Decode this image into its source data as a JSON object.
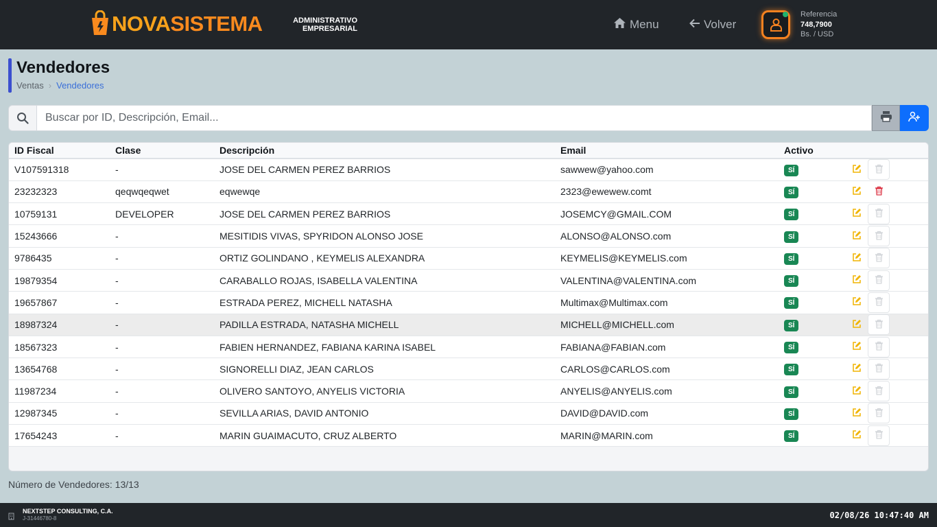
{
  "header": {
    "logo_part1": "NOVA",
    "logo_part2": "SISTEMA",
    "subtitle_line1": "ADMINISTRATIVO",
    "subtitle_line2": "EMPRESARIAL",
    "menu_label": "Menu",
    "back_label": "Volver",
    "reference_label": "Referencia",
    "reference_rate": "748,7900",
    "reference_currency": "Bs. / USD"
  },
  "page": {
    "title": "Vendedores",
    "breadcrumb": [
      "Ventas",
      "Vendedores"
    ]
  },
  "search": {
    "placeholder": "Buscar por ID, Descripción, Email..."
  },
  "table": {
    "columns": [
      "ID Fiscal",
      "Clase",
      "Descripción",
      "Email",
      "Activo"
    ],
    "rows": [
      {
        "id": "V107591318",
        "clase": "-",
        "descripcion": "JOSE DEL CARMEN PEREZ BARRIOS",
        "email": "sawwew@yahoo.com",
        "activo": "SÍ",
        "deletable": false
      },
      {
        "id": "23232323",
        "clase": "qeqwqeqwet",
        "descripcion": "eqwewqe",
        "email": "2323@ewewew.comt",
        "activo": "SÍ",
        "deletable": true
      },
      {
        "id": "10759131",
        "clase": "DEVELOPER",
        "descripcion": "JOSE DEL CARMEN PEREZ BARRIOS",
        "email": "JOSEMCY@GMAIL.COM",
        "activo": "SÍ",
        "deletable": false
      },
      {
        "id": "15243666",
        "clase": "-",
        "descripcion": "MESITIDIS VIVAS, SPYRIDON ALONSO JOSE",
        "email": "ALONSO@ALONSO.com",
        "activo": "SÍ",
        "deletable": false
      },
      {
        "id": "9786435",
        "clase": "-",
        "descripcion": "ORTIZ GOLINDANO , KEYMELIS ALEXANDRA",
        "email": "KEYMELIS@KEYMELIS.com",
        "activo": "SÍ",
        "deletable": false
      },
      {
        "id": "19879354",
        "clase": "-",
        "descripcion": "CARABALLO ROJAS, ISABELLA VALENTINA",
        "email": "VALENTINA@VALENTINA.com",
        "activo": "SÍ",
        "deletable": false
      },
      {
        "id": "19657867",
        "clase": "-",
        "descripcion": "ESTRADA PEREZ, MICHELL NATASHA",
        "email": "Multimax@Multimax.com",
        "activo": "SÍ",
        "deletable": false
      },
      {
        "id": "18987324",
        "clase": "-",
        "descripcion": "PADILLA ESTRADA, NATASHA MICHELL",
        "email": "MICHELL@MICHELL.com",
        "activo": "SÍ",
        "deletable": false,
        "highlighted": true
      },
      {
        "id": "18567323",
        "clase": "-",
        "descripcion": "FABIEN HERNANDEZ, FABIANA KARINA ISABEL",
        "email": "FABIANA@FABIAN.com",
        "activo": "SÍ",
        "deletable": false
      },
      {
        "id": "13654768",
        "clase": "-",
        "descripcion": "SIGNORELLI DIAZ, JEAN CARLOS",
        "email": "CARLOS@CARLOS.com",
        "activo": "SÍ",
        "deletable": false
      },
      {
        "id": "11987234",
        "clase": "-",
        "descripcion": "OLIVERO SANTOYO, ANYELIS VICTORIA",
        "email": "ANYELIS@ANYELIS.com",
        "activo": "SÍ",
        "deletable": false
      },
      {
        "id": "12987345",
        "clase": "-",
        "descripcion": "SEVILLA ARIAS, DAVID ANTONIO",
        "email": "DAVID@DAVID.com",
        "activo": "SÍ",
        "deletable": false
      },
      {
        "id": "17654243",
        "clase": "-",
        "descripcion": "MARIN GUAIMACUTO, CRUZ ALBERTO",
        "email": "MARIN@MARIN.com",
        "activo": "SÍ",
        "deletable": false
      }
    ]
  },
  "summary": {
    "count_text": "Número de Vendedores: 13/13"
  },
  "footer": {
    "company": "NEXTSTEP CONSULTING, C.A.",
    "rif": "J-31446780-8",
    "clock": "02/08/26 10:47:40 AM"
  },
  "icons": {
    "logo": "shopping-bag-icon",
    "menu": "home-icon",
    "back": "arrow-left-icon",
    "avatar": "user-icon",
    "search": "search-icon",
    "print": "printer-icon",
    "add": "add-user-icon",
    "edit": "pencil-square-icon",
    "delete": "trash-icon",
    "footer": "building-icon"
  },
  "colors": {
    "accent": "#0d6efd",
    "brand_orange": "#f98a1e",
    "active_badge": "#198754",
    "edit_icon": "#f0b400",
    "delete_icon": "#dc3545"
  }
}
